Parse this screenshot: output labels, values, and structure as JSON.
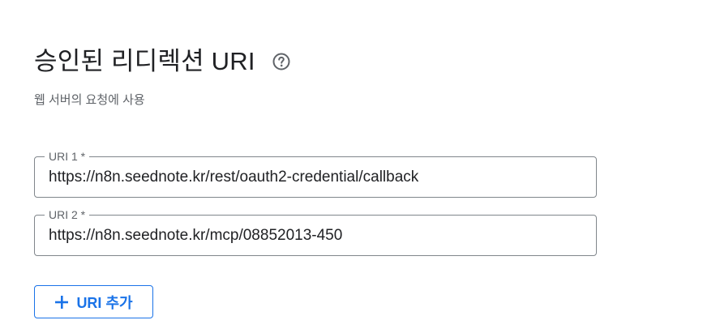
{
  "section": {
    "title": "승인된 리디렉션 URI",
    "subtitle": "웹 서버의 요청에 사용",
    "help_icon": "help-circle-icon"
  },
  "uris": [
    {
      "label": "URI 1 *",
      "value": "https://n8n.seednote.kr/rest/oauth2-credential/callback"
    },
    {
      "label": "URI 2 *",
      "value": "https://n8n.seednote.kr/mcp/08852013-450"
    }
  ],
  "add_button": {
    "label": "URI 추가",
    "icon": "plus-icon"
  },
  "colors": {
    "accent": "#1a73e8",
    "text": "#202124",
    "secondary_text": "#5f6368",
    "border": "#80868b"
  }
}
